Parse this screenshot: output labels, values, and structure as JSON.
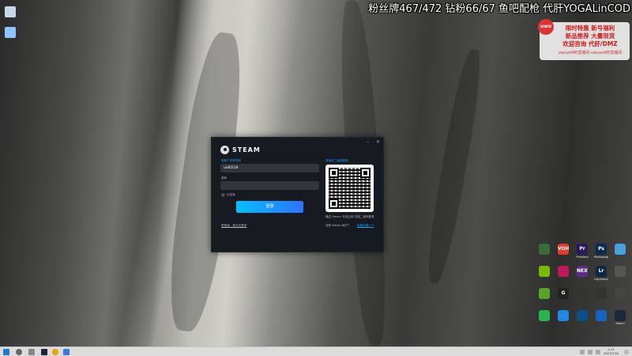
{
  "overlay": {
    "streamer_text": "粉丝牌467/472 钻粉66/67 鱼吧配枪 代肝YOGALinCOD",
    "promo_lines": [
      "限时特惠 新号福利",
      "新品推荐 大量现货",
      "欢迎咨询 代肝/DMZ"
    ],
    "promo_footer": [
      "uwuyoWE直播间",
      "uwuyoWE直播间"
    ],
    "promo_badge": "uwu"
  },
  "steam": {
    "title": "STEAM",
    "account_label": "用账户名称登录",
    "account_value": "uid0218",
    "password_label": "密码",
    "remember_label": "记住我",
    "login_button": "登录",
    "help_link": "帮助我，我无法登录",
    "qr_label": "或者用二维码登录",
    "qr_hint": "通过 Steam 手机应用 扫描二维码登录",
    "no_account_text": "没有 Steam 帐户？",
    "create_account_link": "免费创建一个"
  },
  "taskbar": {
    "time": "1:11",
    "date": "2023/7/22"
  },
  "desktop_icons": [
    {
      "name": "recycle-bin",
      "color": "#c8d7e8"
    },
    {
      "name": "this-pc",
      "color": "#8ec5ff"
    }
  ],
  "grid_icons": [
    {
      "name": "app-1",
      "text": "",
      "label": "",
      "color": "#3a6b3a"
    },
    {
      "name": "app-voice",
      "text": "VOICE",
      "label": "",
      "color": "#e23b2e"
    },
    {
      "name": "premiere",
      "text": "Pr",
      "label": "Premiere",
      "color": "#2a1a5e"
    },
    {
      "name": "photoshop",
      "text": "Ps",
      "label": "Photoshop",
      "color": "#0a2a4e"
    },
    {
      "name": "app-5",
      "text": "",
      "label": "",
      "color": "#4aa0d8"
    },
    {
      "name": "nvidia",
      "text": "",
      "label": "",
      "color": "#76b900"
    },
    {
      "name": "app-7",
      "text": "",
      "label": "",
      "color": "#c2185b"
    },
    {
      "name": "next",
      "text": "NEXT",
      "label": "",
      "color": "#5b2d8a"
    },
    {
      "name": "lightroom",
      "text": "Lr",
      "label": "Lightroom",
      "color": "#0c2a45"
    },
    {
      "name": "app-10",
      "text": "",
      "label": "",
      "color": "#555"
    },
    {
      "name": "geforce",
      "text": "",
      "label": "",
      "color": "#5aa02c"
    },
    {
      "name": "logitech",
      "text": "G",
      "label": "",
      "color": "#222"
    },
    {
      "name": "app-13",
      "text": "",
      "label": "",
      "color": "#333"
    },
    {
      "name": "app-14",
      "text": "",
      "label": "",
      "color": "#333"
    },
    {
      "name": "app-15",
      "text": "",
      "label": "",
      "color": "#444"
    },
    {
      "name": "wechat",
      "text": "",
      "label": "",
      "color": "#2bb24c"
    },
    {
      "name": "app-17",
      "text": "",
      "label": "",
      "color": "#1e88e5"
    },
    {
      "name": "app-18",
      "text": "",
      "label": "",
      "color": "#0b4f8a"
    },
    {
      "name": "app-19",
      "text": "",
      "label": "",
      "color": "#1565c0"
    },
    {
      "name": "steam-icon-grid",
      "text": "",
      "label": "Steam",
      "color": "#1b2838"
    }
  ],
  "colors": {
    "steam_bg": "#181a21",
    "steam_accent": "#1a9fff",
    "login_btn_start": "#06bfff",
    "login_btn_end": "#2d73ff"
  }
}
